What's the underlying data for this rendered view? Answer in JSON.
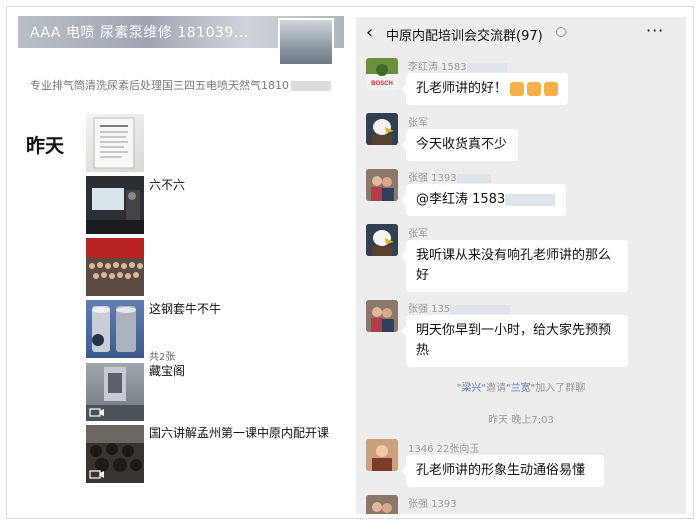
{
  "moments": {
    "cover_title": "AAA 电喷 尿素泵维修 181039...",
    "signature": "专业排气筒清洗尿素后处理国三四五电喷天然气1810",
    "day_label": "昨天",
    "posts": [
      {
        "text": "",
        "sub": ""
      },
      {
        "text": "六不六",
        "sub": ""
      },
      {
        "text": "",
        "sub": ""
      },
      {
        "text": "这钢套牛不牛",
        "sub": "共2张"
      },
      {
        "text": "藏宝阁",
        "sub": ""
      },
      {
        "text": "国六讲解孟州第一课中原内配开课",
        "sub": ""
      }
    ]
  },
  "chat": {
    "title": "中原内配培训会交流群(97)",
    "messages": [
      {
        "name": "李红涛 1583",
        "text": "孔老师讲的好！"
      },
      {
        "name": "张军",
        "text": "今天收货真不少"
      },
      {
        "name": "张强 1393",
        "text": "@李红涛 1583"
      },
      {
        "name": "张军",
        "text": "我听课从来没有响孔老师讲的那么好"
      },
      {
        "name": "张强 135",
        "text": "明天你早到一小时，给大家先预预热"
      },
      {
        "name": "1346 22张向玉",
        "text": "孔老师讲的形象生动通俗易懂"
      },
      {
        "name": "张强 1393",
        "text": ""
      }
    ],
    "system_note": {
      "inviter": "\"梁兴\"",
      "middle": "邀请",
      "invitee": "\"兰宽\"",
      "suffix": "加入了群聊"
    },
    "timestamp": "昨天 晚上7:03"
  }
}
